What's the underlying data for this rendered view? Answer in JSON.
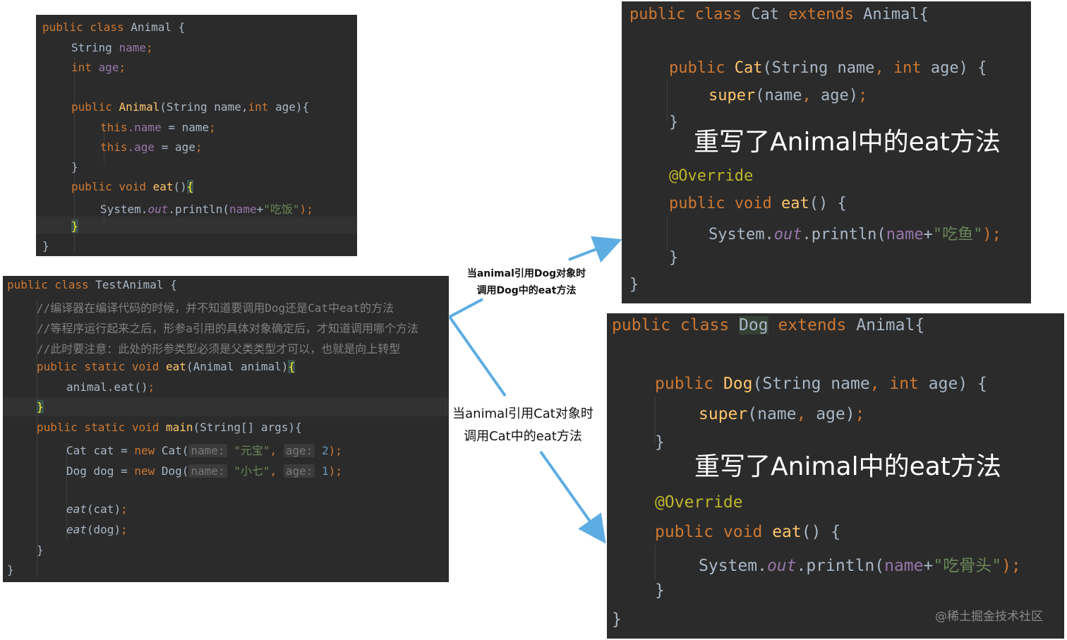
{
  "animal_panel": {
    "l1": {
      "kw": "public class",
      "name": "Animal",
      "rest": " {"
    },
    "l2": {
      "type": "String",
      "field": "name",
      "semi": ";"
    },
    "l3": {
      "type": "int",
      "field": "age",
      "semi": ";"
    },
    "l4": {
      "kw": "public",
      "fn": "Animal",
      "params": "(String name,",
      "int": "int",
      "params2": " age){"
    },
    "l5": {
      "this": "this",
      "field": ".name",
      "rest": " = name",
      "semi": ";"
    },
    "l6": {
      "this": "this",
      "field": ".age",
      "rest": " = age",
      "semi": ";"
    },
    "l7": "}",
    "l8": {
      "kw": "public void",
      "fn": "eat",
      "rest": "()",
      "brace": "{"
    },
    "l9": {
      "pre": "System.",
      "out": "out",
      "mid": ".println(",
      "field": "name",
      "plus": "+",
      "str": "\"吃饭\"",
      "end": ");"
    },
    "l10": "}",
    "l11": "}"
  },
  "test_panel": {
    "l1": {
      "kw": "public class",
      "name": "TestAnimal",
      "rest": " {"
    },
    "c1": "//编译器在编译代码的时候，并不知道要调用Dog还是Cat中eat的方法",
    "c2": "//等程序运行起来之后，形参a引用的具体对象确定后，才知道调用哪个方法",
    "c3": "//此时要注意：此处的形参类型必须是父类类型才可以，也就是向上转型",
    "l2": {
      "kw": "public static void",
      "fn": "eat",
      "params": "(Animal animal)",
      "brace": "{"
    },
    "l3": {
      "code": "animal.eat()",
      "semi": ";"
    },
    "l4": "}",
    "l5": {
      "kw": "public static void",
      "fn": "main",
      "params": "(String[] args){"
    },
    "l6": {
      "pre": "Cat cat = ",
      "new": "new",
      "cls": " Cat(",
      "h1": "name:",
      "s1": "\"元宝\"",
      "comma": ",",
      "h2": "age:",
      "n": " 2",
      "end": ");"
    },
    "l7": {
      "pre": "Dog dog = ",
      "new": "new",
      "cls": " Dog(",
      "h1": "name:",
      "s1": "\"小七\"",
      "comma": ",",
      "h2": "age:",
      "n": " 1",
      "end": ");"
    },
    "l8": {
      "fn": "eat",
      "args": "(cat)",
      "semi": ";"
    },
    "l9": {
      "fn": "eat",
      "args": "(dog)",
      "semi": ";"
    },
    "l10": "}",
    "l11": "}"
  },
  "cat_panel": {
    "l1": {
      "kw": "public class",
      "name": "Cat",
      "kw2": "extends",
      "rest": "Animal{"
    },
    "l2": {
      "kw": "public",
      "fn": "Cat",
      "p1": "(String name",
      "comma": ",",
      "int": "int",
      "p2": " age) {"
    },
    "l3": {
      "fn": "super",
      "args": "(name",
      "comma": ",",
      "args2": " age)",
      "semi": ";"
    },
    "l4": "}",
    "overlay": "重写了Animal中的eat方法",
    "ann": "@Override",
    "l5": {
      "kw": "public void",
      "fn": "eat",
      "rest": "() {"
    },
    "l6": {
      "pre": "System.",
      "out": "out",
      "mid": ".println(",
      "field": "name",
      "plus": "+",
      "str": "\"吃鱼\"",
      "end": ");"
    },
    "l7": "}",
    "l8": "}"
  },
  "dog_panel": {
    "l1": {
      "kw": "public class",
      "name": "Dog",
      "kw2": "extends",
      "rest": "Animal{"
    },
    "l2": {
      "kw": "public",
      "fn": "Dog",
      "p1": "(String name",
      "comma": ",",
      "int": "int",
      "p2": " age) {"
    },
    "l3": {
      "fn": "super",
      "args": "(name",
      "comma": ",",
      "args2": " age)",
      "semi": ";"
    },
    "l4": "}",
    "overlay": "重写了Animal中的eat方法",
    "ann": "@Override",
    "l5": {
      "kw": "public void",
      "fn": "eat",
      "rest": "() {"
    },
    "l6": {
      "pre": "System.",
      "out": "out",
      "mid": ".println(",
      "field": "name",
      "plus": "+",
      "str": "\"吃骨头\"",
      "end": ");"
    },
    "l7": "}",
    "l8": "}"
  },
  "labels": {
    "dog_line1": "当animal引用Dog对象时",
    "dog_line2": "调用Dog中的eat方法",
    "cat_line1": "当animal引用Cat对象时",
    "cat_line2": "调用Cat中的eat方法"
  },
  "watermark": "@稀土掘金技术社区",
  "colors": {
    "arrow": "#5dade2",
    "editor_bg": "#2b2b2b",
    "keyword": "#cc7832",
    "function": "#ffc66d",
    "field": "#9876aa",
    "string": "#6a8759",
    "comment": "#808080",
    "annotation": "#bbb529"
  }
}
